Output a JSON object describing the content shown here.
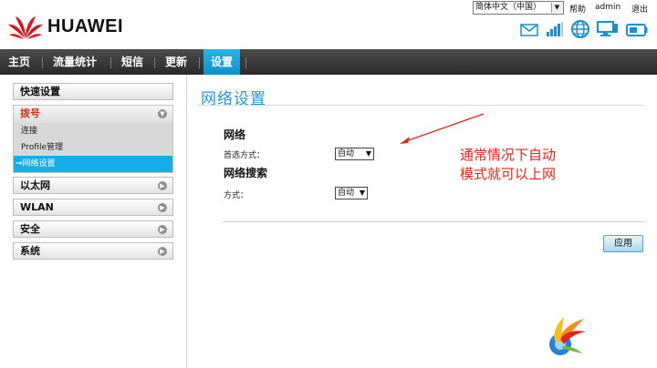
{
  "header": {
    "brand": "HUAWEI",
    "language": "简体中文（中国）",
    "help": "帮助",
    "user": "admin",
    "logout": "退出",
    "status_icons": [
      "mail-icon",
      "signal-icon",
      "internet-globe-icon",
      "connected-pc-icon",
      "battery-icon"
    ]
  },
  "nav": {
    "items": [
      "主页",
      "流量统计",
      "短信",
      "更新",
      "设置"
    ],
    "active": "设置"
  },
  "sidebar": {
    "quick_setup": "快速设置",
    "dialup": {
      "label": "拨号",
      "items": [
        "连接",
        "Profile管理",
        "⇒网络设置"
      ]
    },
    "ethernet": "以太网",
    "wlan": "WLAN",
    "security": "安全",
    "system": "系统"
  },
  "main": {
    "page_title": "网络设置",
    "network_section": "网络",
    "preferred_mode_label": "首选方式：",
    "preferred_mode_value": "自动",
    "search_section": "网络搜索",
    "search_mode_label": "方式：",
    "search_mode_value": "自动",
    "apply_label": "应用"
  },
  "annotation": {
    "line1": "通常情况下自动",
    "line2": "模式就可以上网"
  },
  "colors": {
    "accent": "#1d9ad6",
    "nav_active": "#14aee8",
    "annotation": "#e2241a",
    "brand_red": "#d8141c"
  }
}
